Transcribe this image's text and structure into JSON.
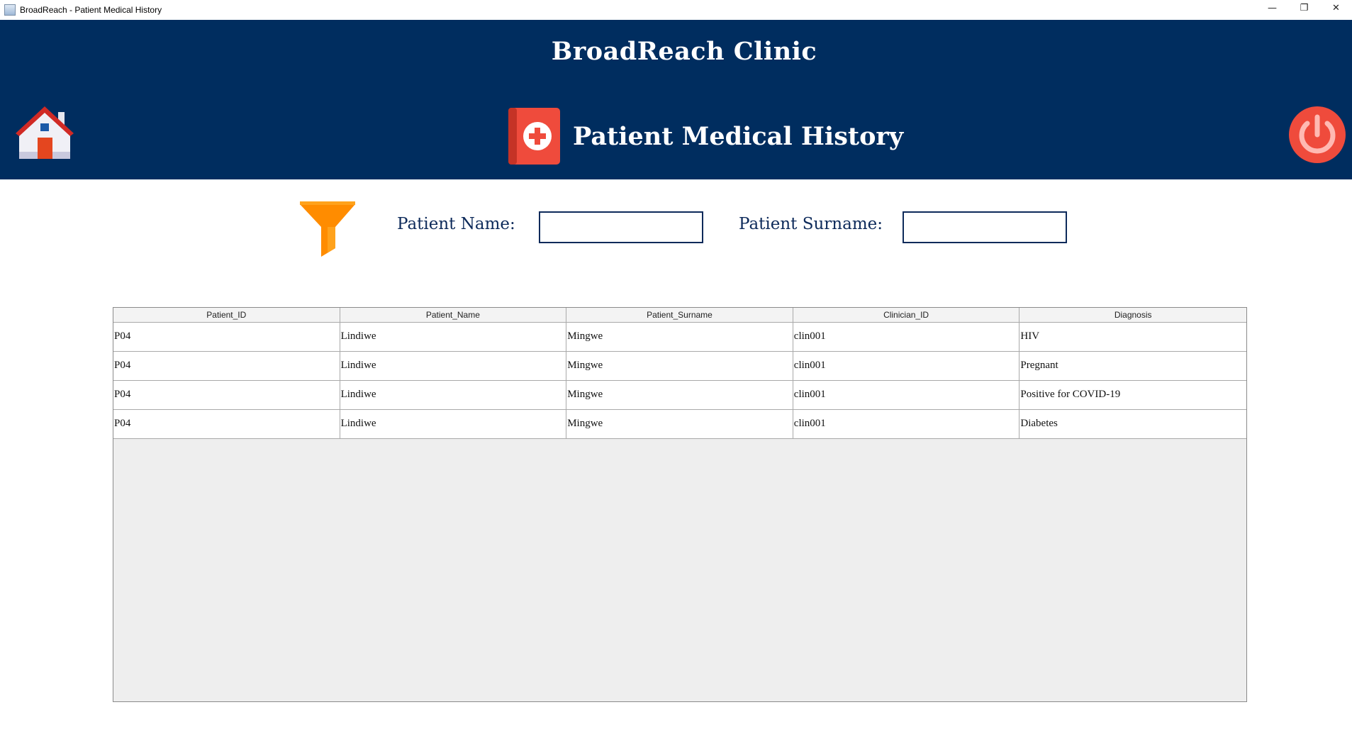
{
  "window": {
    "title": "BroadReach - Patient Medical History",
    "controls": {
      "minimize": "—",
      "restore": "❐",
      "close": "✕"
    }
  },
  "header": {
    "clinic_name": "BroadReach Clinic",
    "page_title": "Patient Medical History",
    "background_color": "#002d5f"
  },
  "filter": {
    "name_label": "Patient Name:",
    "name_value": "",
    "surname_label": "Patient Surname:",
    "surname_value": ""
  },
  "table": {
    "columns": [
      "Patient_ID",
      "Patient_Name",
      "Patient_Surname",
      "Clinician_ID",
      "Diagnosis"
    ],
    "rows": [
      [
        "P04",
        "Lindiwe",
        "Mingwe",
        "clin001",
        "HIV"
      ],
      [
        "P04",
        "Lindiwe",
        "Mingwe",
        "clin001",
        "Pregnant"
      ],
      [
        "P04",
        "Lindiwe",
        "Mingwe",
        "clin001",
        "Positive for COVID-19"
      ],
      [
        "P04",
        "Lindiwe",
        "Mingwe",
        "clin001",
        "Diabetes"
      ]
    ]
  },
  "icons": {
    "home": "home-icon",
    "medical": "medical-book-icon",
    "power": "power-icon",
    "filter": "filter-funnel-icon"
  },
  "colors": {
    "header": "#002d5f",
    "accent_red": "#ef4b3c",
    "filter_orange": "#ff8c00"
  }
}
